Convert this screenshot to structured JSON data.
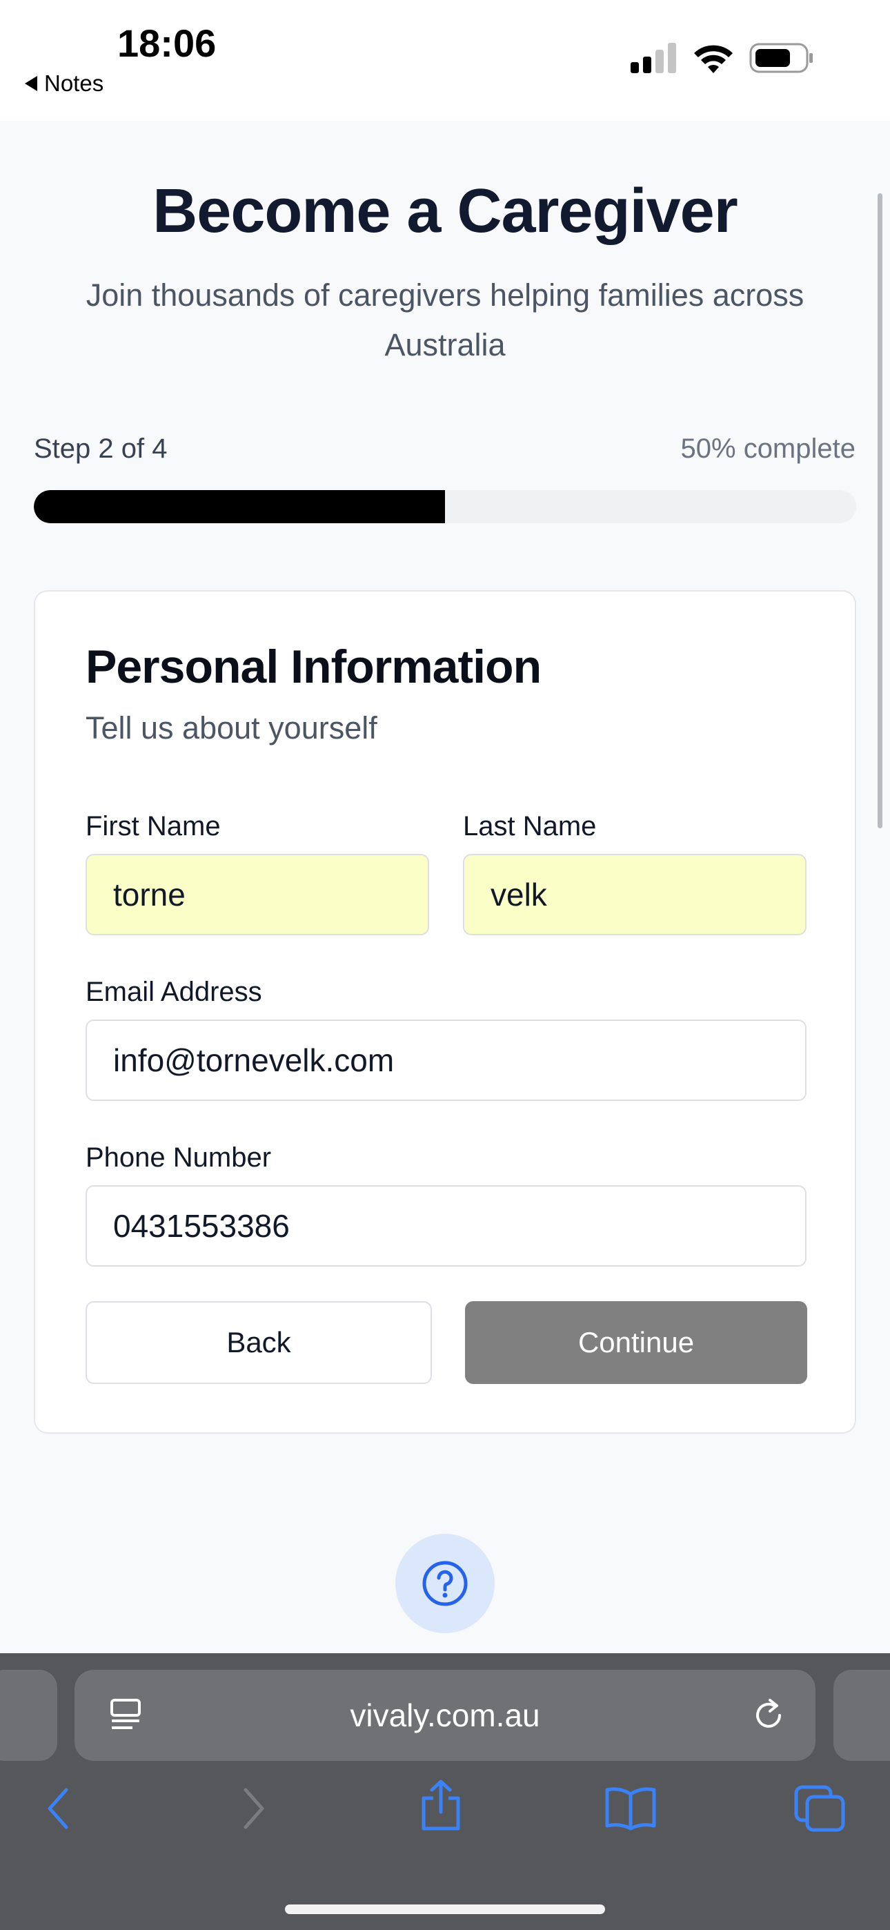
{
  "status_bar": {
    "time": "18:06",
    "back_label": "Notes",
    "icons": [
      "cellular-signal-icon",
      "wifi-icon",
      "battery-icon"
    ]
  },
  "header": {
    "title": "Become a Caregiver",
    "subtitle": "Join thousands of caregivers helping families across Australia"
  },
  "progress": {
    "step_label": "Step 2 of 4",
    "percent_label": "50% complete",
    "fraction": 0.5
  },
  "card": {
    "title": "Personal Information",
    "subtitle": "Tell us about yourself",
    "fields": {
      "first_name": {
        "label": "First Name",
        "value": "torne"
      },
      "last_name": {
        "label": "Last Name",
        "value": "velk"
      },
      "email": {
        "label": "Email Address",
        "value": "info@tornevelk.com"
      },
      "phone": {
        "label": "Phone Number",
        "value": "0431553386"
      }
    },
    "buttons": {
      "back": "Back",
      "continue": "Continue"
    }
  },
  "help": {
    "icon": "help-circle-icon"
  },
  "browser": {
    "url": "vivaly.com.au",
    "toolbar_icons": [
      "back-arrow-icon",
      "forward-arrow-icon",
      "share-icon",
      "bookmarks-icon",
      "tabs-icon"
    ]
  },
  "colors": {
    "title": "#111a2e",
    "progress_fill": "#000000",
    "autofill_bg": "#fafec7",
    "continue_bg": "#808080",
    "help_bg": "#dbe7fb",
    "browser_blue": "#3b82f6"
  }
}
